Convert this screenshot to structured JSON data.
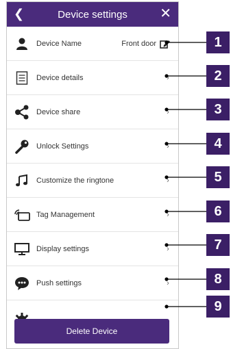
{
  "header": {
    "title": "Device settings",
    "back_icon": "back-chevron-icon",
    "close_icon": "close-icon"
  },
  "rows": [
    {
      "label": "Device Name",
      "value": "Front door",
      "icon": "person-icon",
      "trailing_icon": "edit-icon"
    },
    {
      "label": "Device details",
      "icon": "document-icon"
    },
    {
      "label": "Device share",
      "icon": "share-icon"
    },
    {
      "label": "Unlock Settings",
      "icon": "key-icon"
    },
    {
      "label": "Customize the ringtone",
      "icon": "music-note-icon"
    },
    {
      "label": "Tag Management",
      "icon": "tag-nfc-icon"
    },
    {
      "label": "Display settings",
      "icon": "monitor-icon"
    },
    {
      "label": "Push settings",
      "icon": "chat-bubble-icon"
    }
  ],
  "delete_button": "Delete Device",
  "callouts": [
    "1",
    "2",
    "3",
    "4",
    "5",
    "6",
    "7",
    "8",
    "9"
  ],
  "colors": {
    "accent": "#4a2b7c",
    "badge": "#3b1f66"
  }
}
